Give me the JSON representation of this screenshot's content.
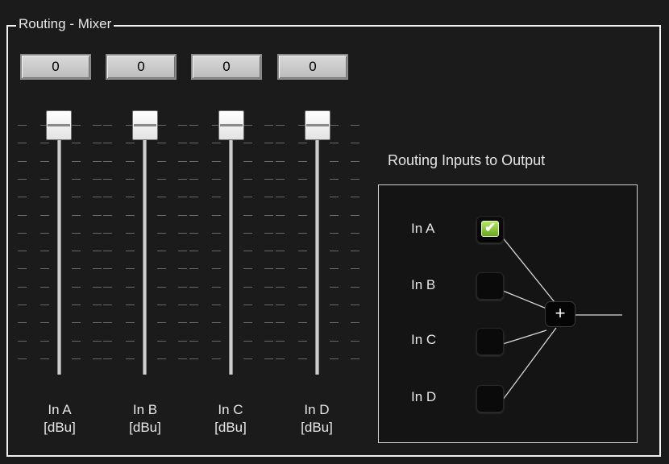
{
  "group": {
    "title": "Routing - Mixer"
  },
  "faders": [
    {
      "value": "0",
      "label": "In A",
      "unit": "[dBu]"
    },
    {
      "value": "0",
      "label": "In B",
      "unit": "[dBu]"
    },
    {
      "value": "0",
      "label": "In C",
      "unit": "[dBu]"
    },
    {
      "value": "0",
      "label": "In D",
      "unit": "[dBu]"
    }
  ],
  "routing": {
    "title": "Routing Inputs  to Output",
    "inputs": [
      {
        "label": "In A",
        "checked": true
      },
      {
        "label": "In B",
        "checked": false
      },
      {
        "label": "In C",
        "checked": false
      },
      {
        "label": "In D",
        "checked": false
      }
    ],
    "sum_symbol": "+",
    "check_mark": "✔"
  },
  "colors": {
    "background": "#1b1b1b",
    "checkbox_on": "#8cc63f",
    "frame": "#f2f2f2"
  }
}
